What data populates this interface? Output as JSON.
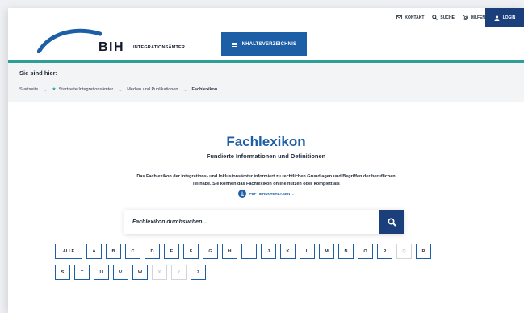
{
  "header": {
    "logo_text": "BIH",
    "logo_subtitle": "INTEGRATIONSÄMTER",
    "toc_label": "INHALTSVERZEICHNIS",
    "nav": [
      {
        "label": "KONTAKT",
        "icon": "mail-icon"
      },
      {
        "label": "SUCHE",
        "icon": "search-icon"
      },
      {
        "label": "HILFEN",
        "icon": "help-icon"
      }
    ],
    "login_label": "LOGIN"
  },
  "breadcrumb": {
    "title": "Sie sind hier:",
    "items": [
      "Startseite",
      "Startseite Integrationsämter",
      "Medien und Publikationen",
      "Fachlexikon"
    ]
  },
  "main": {
    "title": "Fachlexikon",
    "subtitle": "Fundierte Informationen und Definitionen",
    "intro": "Das Fachlexikon der Integrations- und Inklusionsämter informiert zu rechtlichen Grundlagen und Begriffen der beruflichen Teilhabe. Sie können das Fachlexikon online nutzen oder komplett als",
    "pdf_label": "PDF HERUNTERLADEN",
    "pdf_suffix": ".",
    "search_placeholder": "Fachlexikon durchsuchen..."
  },
  "alphabet": {
    "all_label": "ALLE",
    "row1": [
      "A",
      "B",
      "C",
      "D",
      "E",
      "F",
      "G",
      "H",
      "I",
      "J",
      "K",
      "L",
      "M",
      "N",
      "O",
      "P",
      "Q",
      "R"
    ],
    "row2": [
      "S",
      "T",
      "U",
      "V",
      "W",
      "X",
      "Y",
      "Z"
    ],
    "disabled": [
      "Q",
      "X",
      "Y"
    ]
  },
  "colors": {
    "accent": "#1d5fa6",
    "dark_blue": "#1b3f7a",
    "teal": "#2f9e99"
  }
}
